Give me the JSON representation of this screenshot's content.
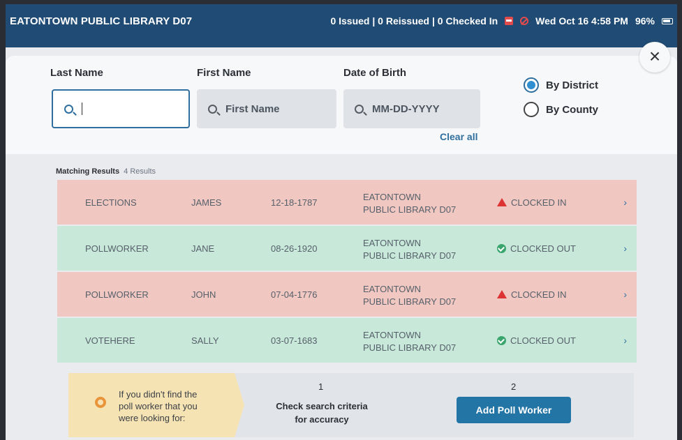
{
  "status_bar": {
    "device_name": "EATONTOWN PUBLIC LIBRARY D07",
    "counts": "0 Issued | 0 Reissued | 0 Checked In",
    "datetime": "Wed Oct 16  4:58 PM",
    "battery": "96%",
    "icons": [
      "printer-icon",
      "no-entry-icon",
      "battery-icon"
    ]
  },
  "search": {
    "last_name_label": "Last Name",
    "first_name_label": "First Name",
    "dob_label": "Date of Birth",
    "last_name_value": "",
    "first_name_placeholder": "First Name",
    "dob_placeholder": "MM-DD-YYYY",
    "clear_all": "Clear all",
    "scope_options": [
      {
        "label": "By District",
        "selected": true
      },
      {
        "label": "By County",
        "selected": false
      }
    ]
  },
  "results": {
    "header": "Matching Results",
    "count_text": "4 Results",
    "rows": [
      {
        "role": "ELECTIONS",
        "first_name": "JAMES",
        "dob": "12-18-1787",
        "location_line1": "EATONTOWN",
        "location_line2": "PUBLIC LIBRARY D07",
        "status": "CLOCKED IN",
        "status_type": "in"
      },
      {
        "role": "POLLWORKER",
        "first_name": "JANE",
        "dob": "08-26-1920",
        "location_line1": "EATONTOWN",
        "location_line2": "PUBLIC LIBRARY D07",
        "status": "CLOCKED OUT",
        "status_type": "out"
      },
      {
        "role": "POLLWORKER",
        "first_name": "JOHN",
        "dob": "07-04-1776",
        "location_line1": "EATONTOWN",
        "location_line2": "PUBLIC LIBRARY D07",
        "status": "CLOCKED IN",
        "status_type": "in"
      },
      {
        "role": "VOTEHERE",
        "first_name": "SALLY",
        "dob": "03-07-1683",
        "location_line1": "EATONTOWN",
        "location_line2": "PUBLIC LIBRARY D07",
        "status": "CLOCKED OUT",
        "status_type": "out"
      }
    ],
    "chevron": "›"
  },
  "help": {
    "line1": "If you didn't find the",
    "line2": "poll worker that you",
    "line3": "were looking for:",
    "step1_number": "1",
    "step1_line1": "Check search criteria",
    "step1_line2": "for accuracy",
    "step2_number": "2",
    "add_button": "Add Poll Worker"
  },
  "colors": {
    "header_bg": "#1f4b74",
    "clocked_in_row": "#f0c7c1",
    "clocked_out_row": "#c8e8da",
    "accent": "#2375a6"
  }
}
